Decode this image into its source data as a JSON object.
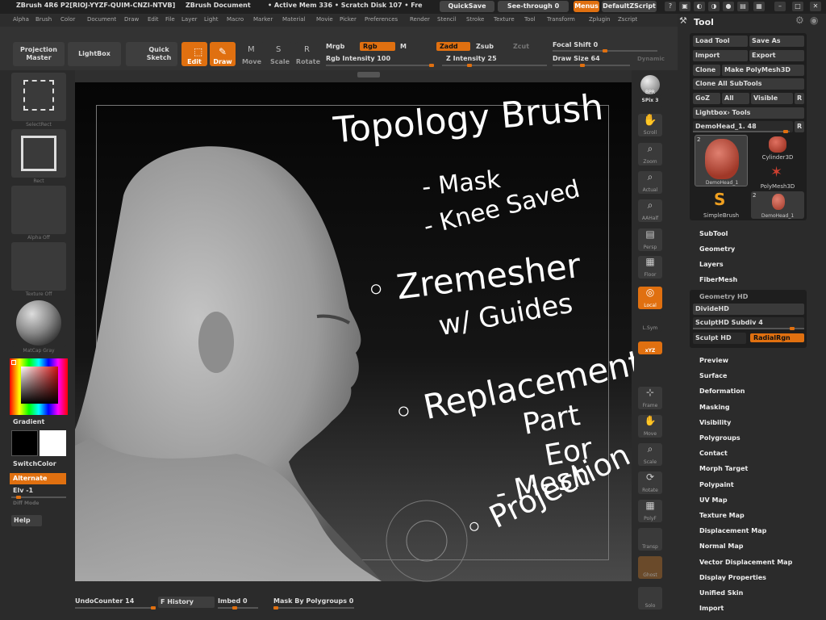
{
  "titlebar": {
    "app": "ZBrush 4R6 P2[RIOJ-YYZF-QUIM-CNZI-NTVB]",
    "document": "ZBrush Document",
    "mem": "• Active Mem 336 • Scratch Disk 107 • Fre",
    "quicksave": "QuickSave",
    "seethrough": "See-through  0",
    "menus": "Menus",
    "script": "DefaultZScript"
  },
  "menubar": [
    "Alpha",
    "Brush",
    "Color",
    "Document",
    "Draw",
    "Edit",
    "File",
    "Layer",
    "Light",
    "Macro",
    "Marker",
    "Material",
    "Movie",
    "Picker",
    "Preferences",
    "Render",
    "Stencil",
    "Stroke",
    "Texture",
    "Tool",
    "Transform",
    "Zplugin",
    "Zscript"
  ],
  "shelf": {
    "projection_master": "Projection Master",
    "lightbox": "LightBox",
    "quick_sketch": "Quick Sketch",
    "edit": "Edit",
    "draw": "Draw",
    "move": "Move",
    "scale": "Scale",
    "rotate": "Rotate",
    "mrgb": "Mrgb",
    "rgb": "Rgb",
    "m": "M",
    "rgb_intensity": "Rgb Intensity 100",
    "zadd": "Zadd",
    "zsub": "Zsub",
    "zcut": "Zcut",
    "z_intensity": "Z Intensity 25",
    "focal_shift": "Focal Shift 0",
    "draw_size": "Draw Size 64",
    "dynamic": "Dynamic",
    "rgb_intensity_value": 100,
    "z_intensity_value": 25,
    "draw_size_value": 64
  },
  "left": {
    "brush_caption": "SelectRect",
    "stroke_caption": "Rect",
    "alpha_caption": "Alpha Off",
    "texture_caption": "Texture Off",
    "material_caption": "MatCap Gray",
    "gradient": "Gradient",
    "switchcolor": "SwitchColor",
    "alternate": "Alternate",
    "elv": "Elv -1",
    "edit_mode": "Diff Mode",
    "help": "Help"
  },
  "right_strip": [
    "BPR",
    "SPix 3",
    "Scroll",
    "Zoom",
    "Actual",
    "AAHalf",
    "Persp",
    "Floor",
    "Local",
    "L.Sym",
    "xYZ",
    "Frame",
    "Move",
    "Scale",
    "Rotate",
    "PolyF",
    "Transp",
    "Ghost",
    "Solo"
  ],
  "tool": {
    "header": "Tool",
    "load": "Load Tool",
    "save_as": "Save As",
    "import": "Import",
    "export": "Export",
    "clone": "Clone",
    "make_polymesh": "Make PolyMesh3D",
    "clone_all": "Clone All SubTools",
    "goz": "GoZ",
    "all": "All",
    "visible": "Visible",
    "r": "R",
    "lightbox_tools": "Lightbox› Tools",
    "current": "DemoHead_1. 48",
    "thumbs": {
      "demohead": "DemoHead_1",
      "cylinder": "Cylinder3D",
      "polymesh": "PolyMesh3D",
      "simplebrush": "SimpleBrush",
      "demohead2": "DemoHead_1",
      "count1": "2",
      "count2": "2"
    },
    "subtool": "SubTool",
    "geometry": "Geometry",
    "layers": "Layers",
    "fibermesh": "FiberMesh",
    "geometry_hd": "Geometry HD",
    "dividehd": "DivideHD",
    "sculpthd_subdiv": "SculptHD Subdiv 4",
    "sculpt_hd": "Sculpt HD",
    "radialrgn": "RadialRgn",
    "items": [
      "Preview",
      "Surface",
      "Deformation",
      "Masking",
      "Visibility",
      "Polygroups",
      "Contact",
      "Morph Target",
      "Polypaint",
      "UV Map",
      "Texture Map",
      "Displacement Map",
      "Normal Map",
      "Vector Displacement Map",
      "Display Properties",
      "Unified Skin",
      "Import"
    ]
  },
  "bottom": {
    "undo": "UndoCounter 14",
    "history": "F History",
    "imbed": "Imbed 0",
    "mask_by_polygroups": "Mask By Polygroups 0"
  },
  "notes": {
    "l1": "Topology Brush",
    "l2": "- Mask",
    "l3": "- Knee Saved",
    "l4": "◦ Zremesher",
    "l5": "w/ Guides",
    "l6": "◦ Replacement",
    "l7": "Part",
    "l8": "Eor",
    "l9": "- Mesh",
    "l10": "◦ Projection"
  }
}
